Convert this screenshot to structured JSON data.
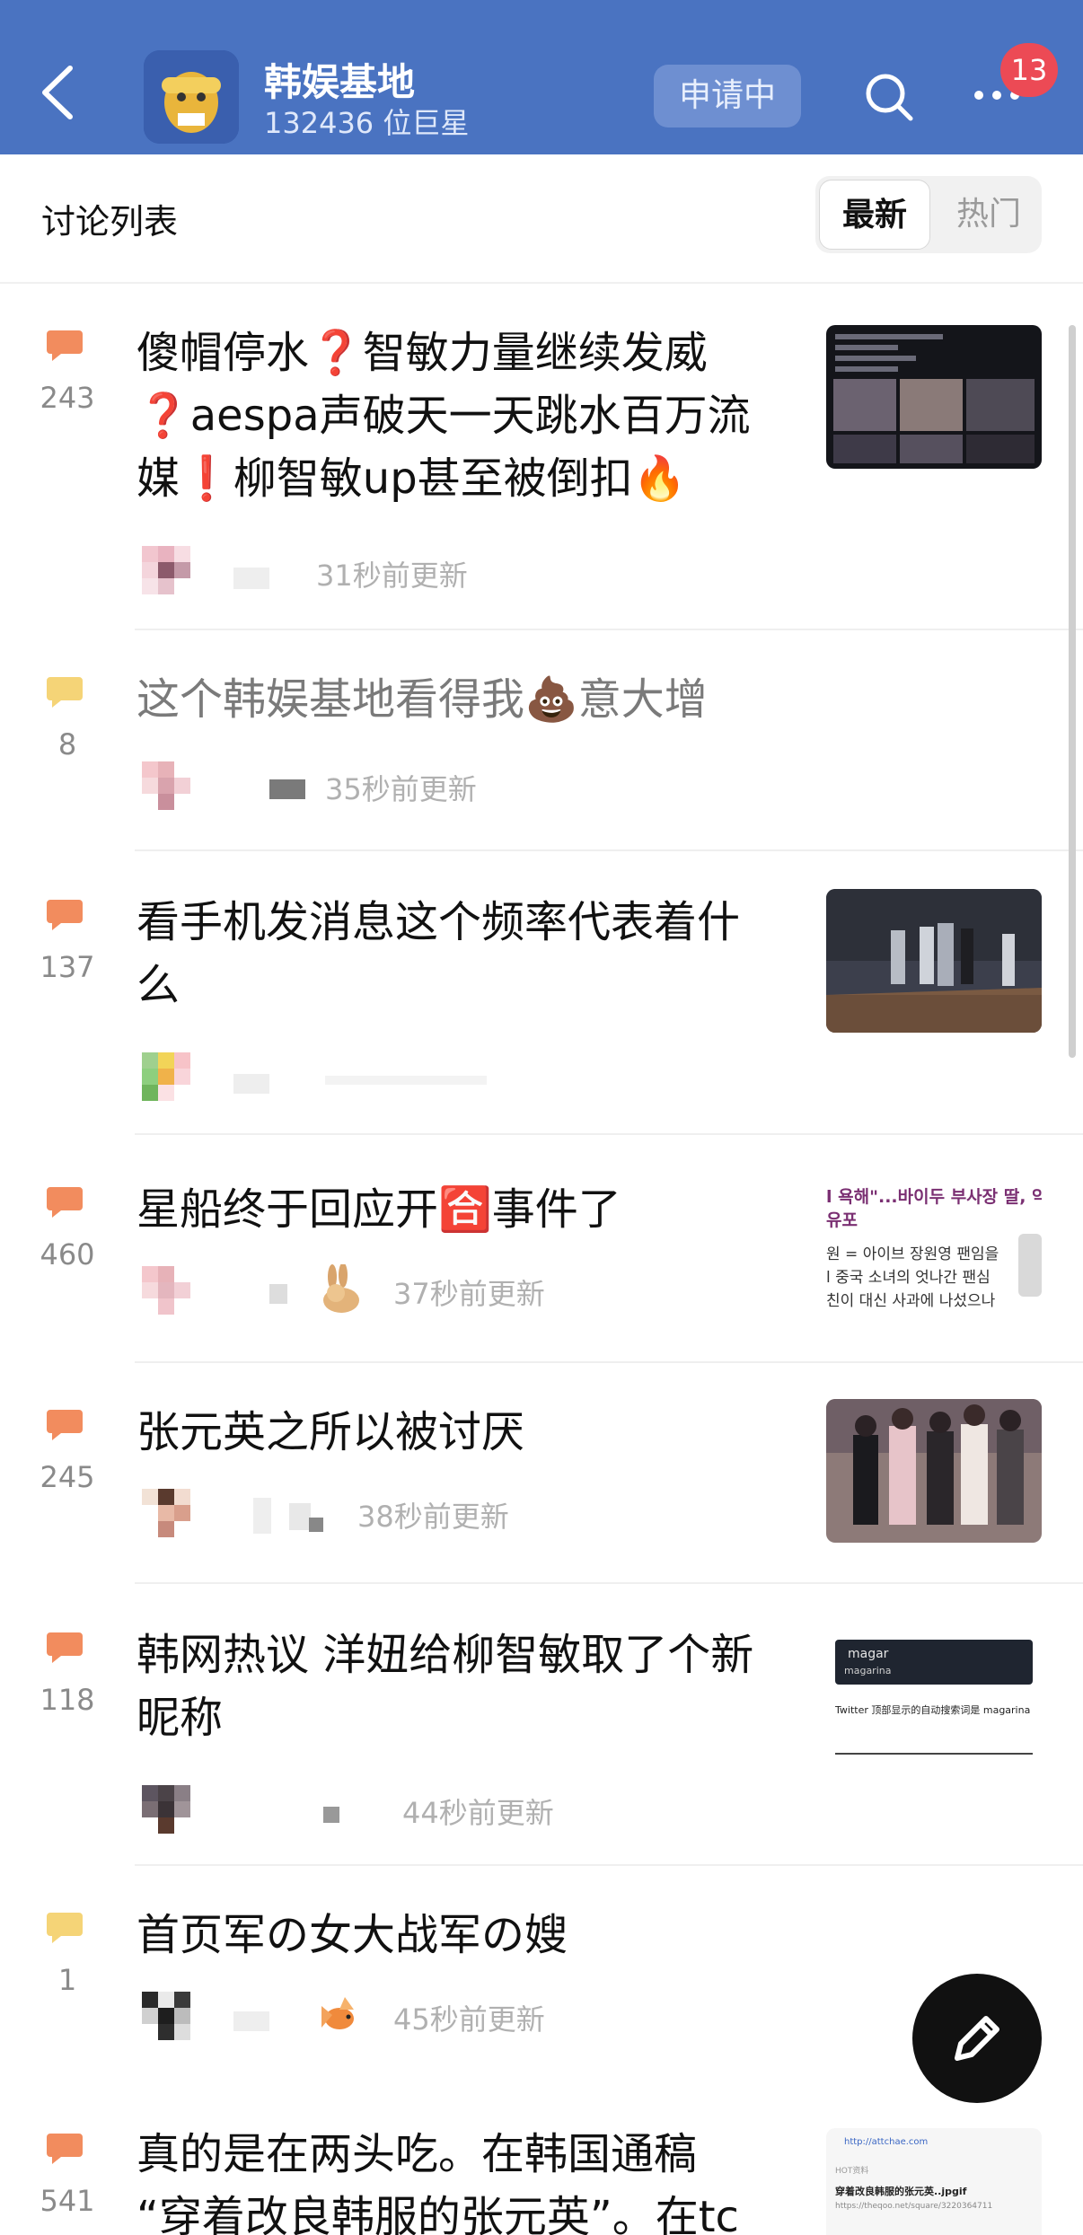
{
  "header": {
    "group_name": "韩娱基地",
    "member_count": "132436 位巨星",
    "apply_label": "申请中",
    "notification_count": "13",
    "icons": [
      "back-arrow-icon",
      "search-icon",
      "more-dots-icon"
    ],
    "bg_color": "#4a73c1"
  },
  "list": {
    "title": "讨论列表",
    "tab_new": "最新",
    "tab_hot": "热门",
    "selected_tab": "最新"
  },
  "posts": [
    {
      "count": "243",
      "comment_icon_color": "#f28c5e",
      "title_lines": [
        "傻帽停水❓智敏力量继续发威",
        "❓aespa声破天一天跳水百万流",
        "媒❗柳智敏up甚至被倒扣🔥"
      ],
      "time": "31秒前更新"
    },
    {
      "count": "8",
      "comment_icon_color": "#f5d477",
      "title_lines": [
        "这个韩娱基地看得我💩意大增"
      ],
      "time": "35秒前更新"
    },
    {
      "count": "137",
      "comment_icon_color": "#f28c5e",
      "title_lines": [
        "看手机发消息这个频率代表着什",
        "么"
      ],
      "time": ""
    },
    {
      "count": "460",
      "comment_icon_color": "#f28c5e",
      "title_lines": [
        "星船终于回应开🈴事件了"
      ],
      "time": "37秒前更新",
      "thumb_text": [
        "l 욕해\"...바이두 부사장 딸, 악플러",
        "유포",
        "원 = 아이브 장원영 팬임을",
        "l 중국 소녀의 엇나간 팬심",
        "친이 대신 사과에 나섰으나"
      ]
    },
    {
      "count": "245",
      "comment_icon_color": "#f28c5e",
      "title_lines": [
        "张元英之所以被讨厌"
      ],
      "time": "38秒前更新"
    },
    {
      "count": "118",
      "comment_icon_color": "#f28c5e",
      "title_lines": [
        "韩网热议 洋妞给柳智敏取了个新",
        "昵称"
      ],
      "time": "44秒前更新",
      "thumb_text": [
        "magar",
        "magarina",
        "Twitter 顶部显示的自动搜索词是 magarina"
      ]
    },
    {
      "count": "1",
      "comment_icon_color": "#f5d477",
      "title_lines": [
        "首页军の女大战军の嫂"
      ],
      "time": "45秒前更新"
    },
    {
      "count": "541",
      "comment_icon_color": "#f28c5e",
      "title_lines": [
        "真的是在两头吃。在韩国通稿",
        "“穿着改良韩服的张元英”。在tc"
      ],
      "time": "",
      "thumb_text": [
        "http://attchae.com",
        "HOT资料",
        "穿着改良韩服的张元英..jpgif",
        "https://theqoo.net/square/3220364711"
      ]
    }
  ],
  "fab_icon": "pencil-icon"
}
